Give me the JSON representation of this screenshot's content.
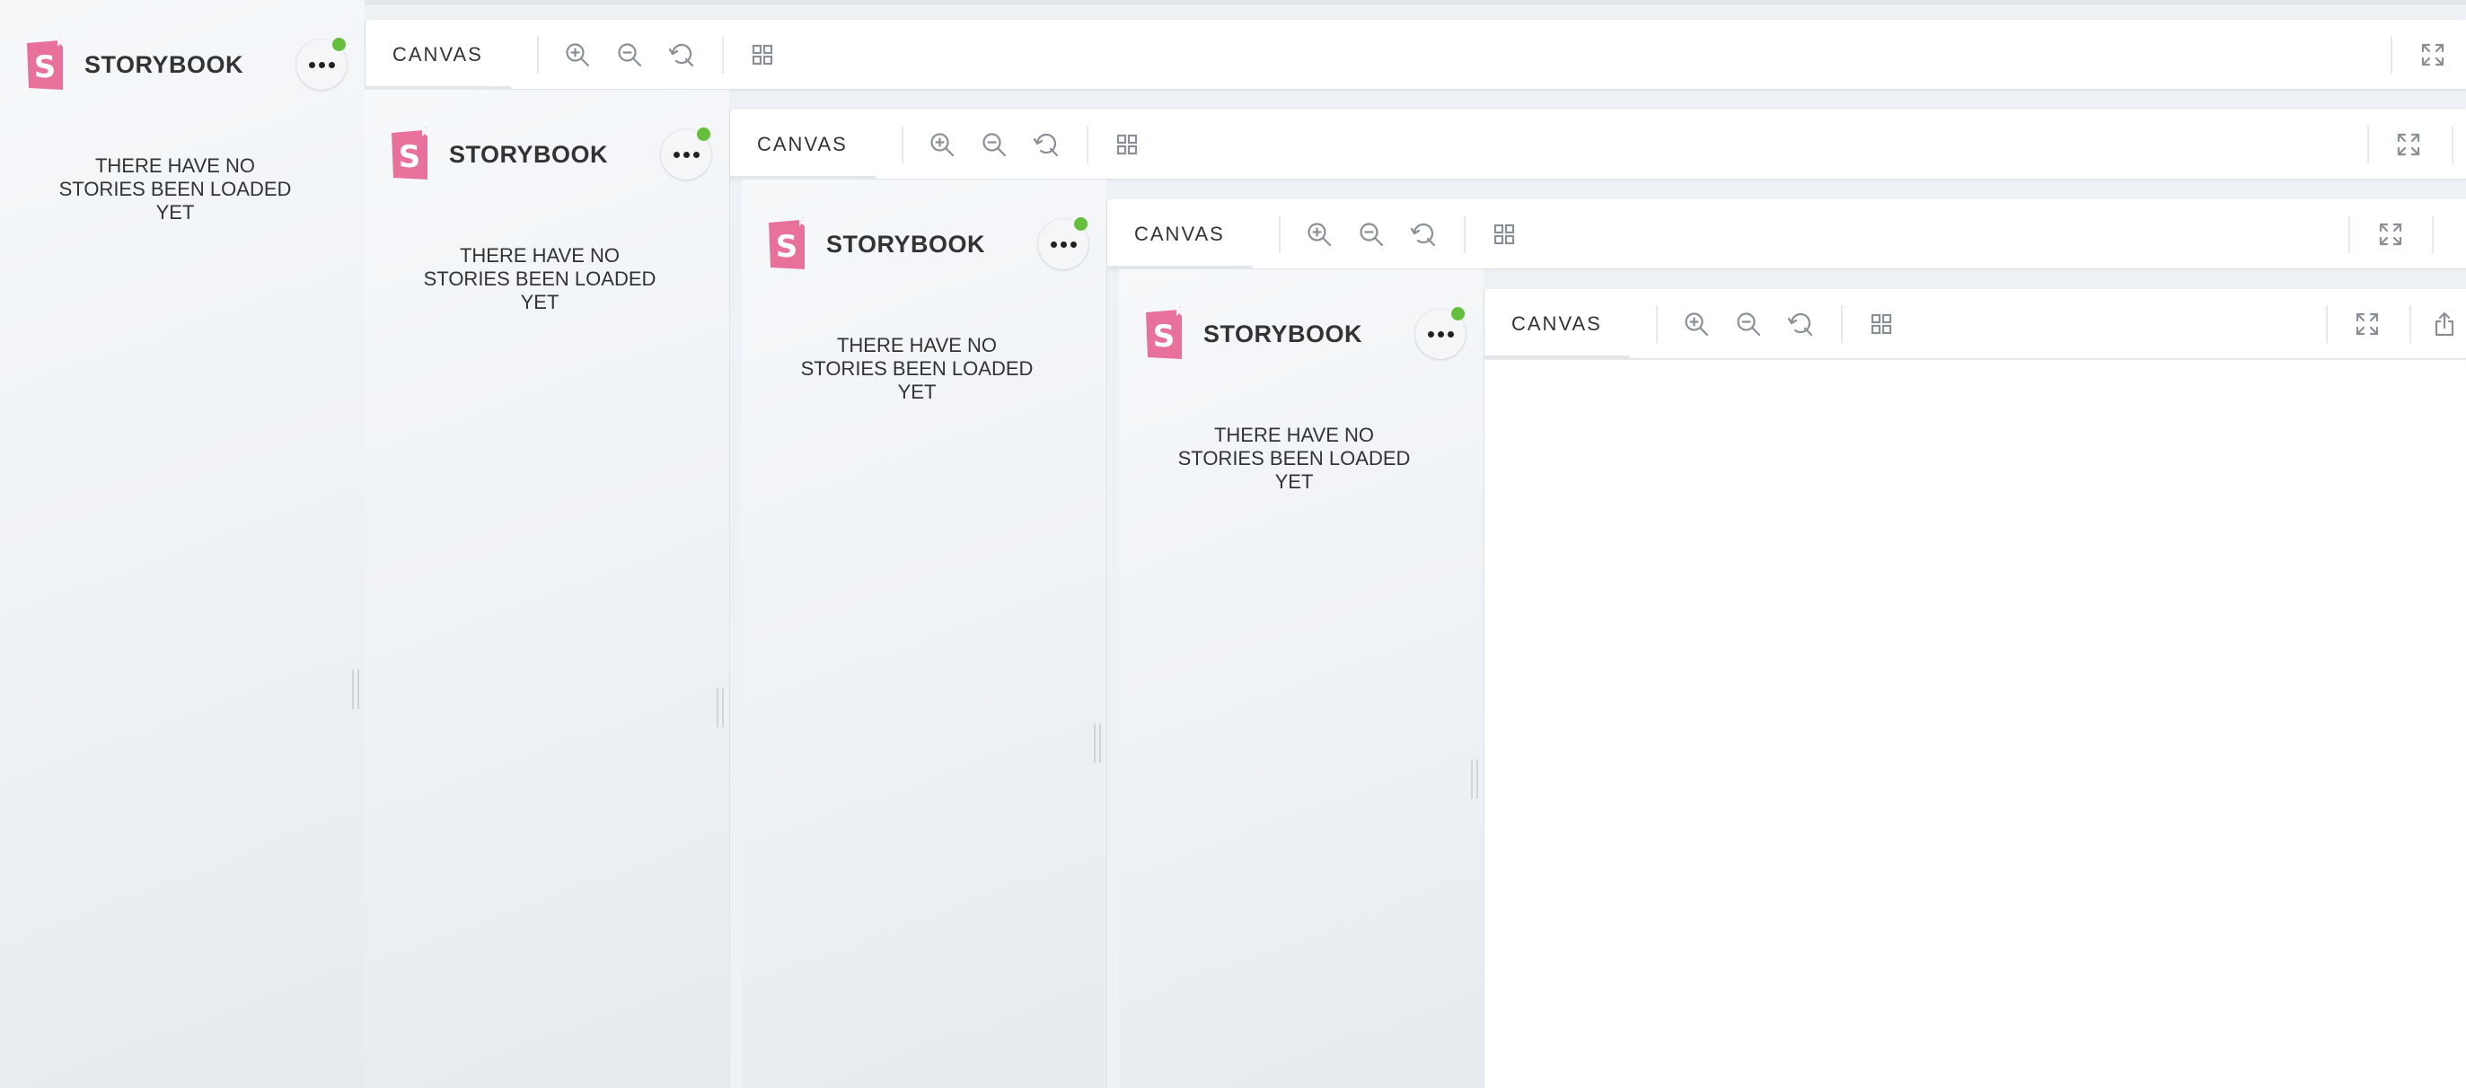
{
  "app": {
    "brand_name": "STORYBOOK",
    "empty_message": "THERE HAVE NO STORIES BEEN LOADED YET",
    "tab_label": "CANVAS",
    "status_color": "#66bf3c",
    "logo_color": "#e7719b"
  },
  "toolbar_icons": [
    "zoom-in-icon",
    "zoom-out-icon",
    "reset-zoom-icon",
    "grid-icon",
    "fullscreen-icon",
    "share-icon"
  ],
  "nesting_levels": 4
}
